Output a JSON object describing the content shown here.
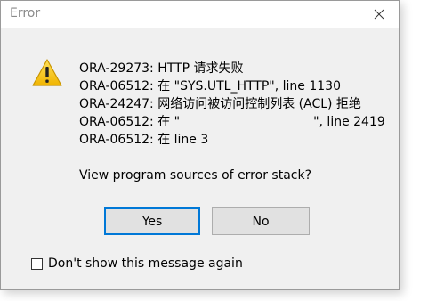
{
  "window": {
    "title": "Error"
  },
  "messages": [
    "ORA-29273: HTTP 请求失败",
    "ORA-06512: 在 \"SYS.UTL_HTTP\", line 1130",
    "ORA-24247: 网络访问被访问控制列表 (ACL) 拒绝"
  ],
  "message_redacted": {
    "prefix": "ORA-06512: 在 \"",
    "suffix": "\", line 2419"
  },
  "message_last": "ORA-06512: 在 line 3",
  "question": "View program sources of error stack?",
  "buttons": {
    "yes": "Yes",
    "no": "No"
  },
  "checkbox": {
    "label": "Don't show this message again",
    "checked": false
  },
  "icons": {
    "warning": "warning-triangle-icon",
    "close": "close-icon"
  },
  "colors": {
    "accent": "#0078d7",
    "warning_fill": "#f5c400"
  }
}
